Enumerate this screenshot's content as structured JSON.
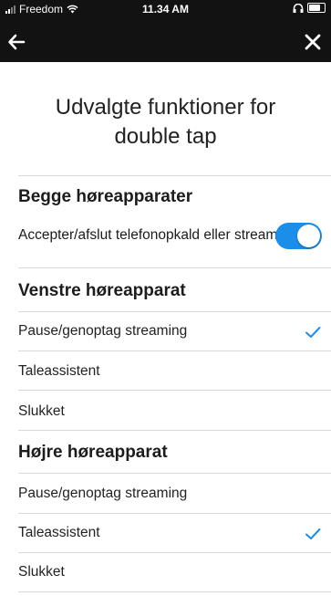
{
  "status_bar": {
    "carrier": "Freedom",
    "time": "11.34 AM",
    "icons": [
      "signal-icon",
      "wifi-icon",
      "headphones-icon",
      "battery-icon"
    ]
  },
  "nav": {
    "back_icon": "arrow-left-icon",
    "close_icon": "close-icon"
  },
  "page": {
    "title_line1": "Udvalgte funktioner for",
    "title_line2": "double tap"
  },
  "both": {
    "heading": "Begge høreapparater",
    "toggle_label": "Accepter/afslut telefonopkald eller streaming",
    "toggle_on": true
  },
  "left": {
    "heading": "Venstre høreapparat",
    "options": [
      {
        "label": "Pause/genoptag streaming",
        "selected": true
      },
      {
        "label": "Taleassistent",
        "selected": false
      },
      {
        "label": "Slukket",
        "selected": false
      }
    ]
  },
  "right": {
    "heading": "Højre høreapparat",
    "options": [
      {
        "label": "Pause/genoptag streaming",
        "selected": false
      },
      {
        "label": "Taleassistent",
        "selected": true
      },
      {
        "label": "Slukket",
        "selected": false
      }
    ]
  },
  "colors": {
    "header_bg": "#121212",
    "accent": "#1a8ee8",
    "divider": "#d9d9d9"
  }
}
